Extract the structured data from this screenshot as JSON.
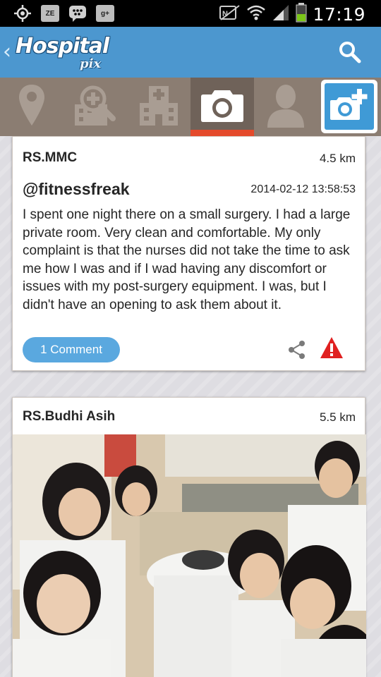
{
  "status_bar": {
    "time": "17:19",
    "notif_icons": [
      "gps-icon",
      "ze-app-icon",
      "bbm-icon",
      "google-plus-icon"
    ],
    "ze_label": "ZE",
    "gplus_label": "g+"
  },
  "app_bar": {
    "logo_text": "Hospital",
    "logo_sub": "pix",
    "back_glyph": "‹"
  },
  "tabs": [
    {
      "name": "location-tab",
      "icon": "map-pin-icon"
    },
    {
      "name": "search-hospital-tab",
      "icon": "hospital-search-icon"
    },
    {
      "name": "hospital-tab",
      "icon": "hospital-building-icon"
    },
    {
      "name": "photos-tab",
      "icon": "camera-icon",
      "active": true
    },
    {
      "name": "profile-tab",
      "icon": "user-icon"
    },
    {
      "name": "add-photo-tab",
      "icon": "camera-add-icon"
    }
  ],
  "colors": {
    "appbar": "#4c97cf",
    "tabbar": "#8b7d72",
    "active_indicator": "#e44a2b",
    "comment_button": "#5aa8df",
    "report_icon": "#e02020"
  },
  "posts": [
    {
      "hospital": "RS.MMC",
      "distance": "4.5 km",
      "user": "@fitnessfreak",
      "timestamp": "2014-02-12 13:58:53",
      "review": "I spent one night there on a small surgery. I had a large private room. Very clean and comfortable. My only complaint is that the nurses did not take the time to ask me how I was and if I wad having any discomfort or issues with my post-surgery equipment.  I was, but I didn't have an opening to ask them about it.",
      "comment_label": "1 Comment"
    },
    {
      "hospital": "RS.Budhi Asih",
      "distance": "5.5 km"
    }
  ]
}
